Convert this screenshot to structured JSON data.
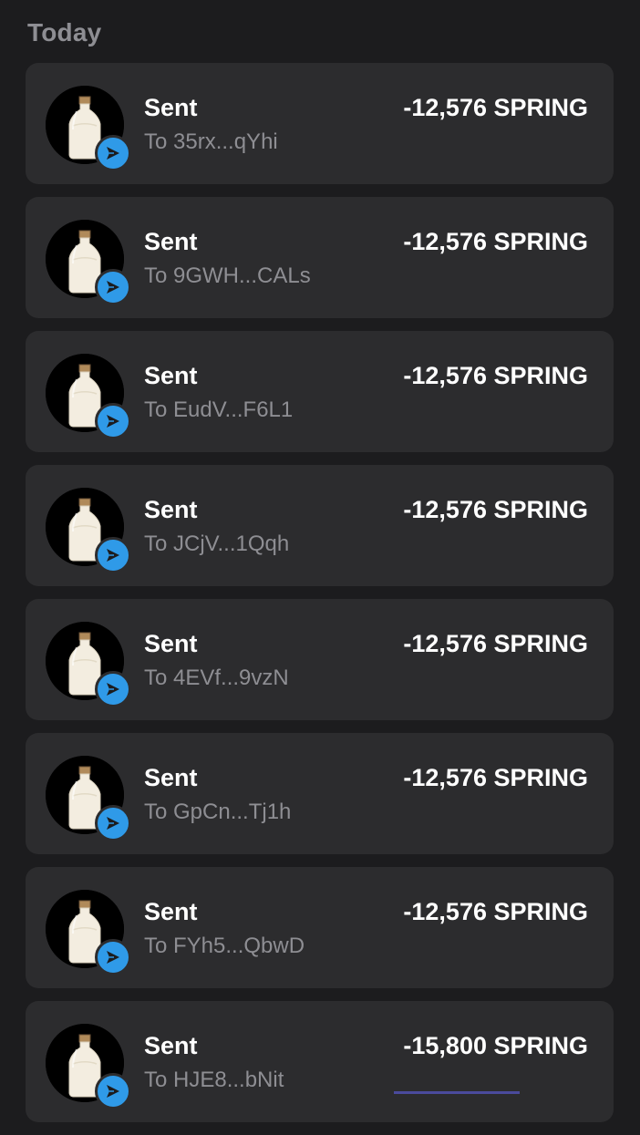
{
  "section": {
    "title": "Today"
  },
  "colors": {
    "background": "#1c1c1e",
    "card": "#2c2c2e",
    "badge": "#2f9ae8",
    "muted_text": "#8e8e93"
  },
  "icons": {
    "avatar": "bottle-icon",
    "badge": "send-icon"
  },
  "transactions": [
    {
      "title": "Sent",
      "recipient": "To 35rx...qYhi",
      "amount": "-12,576 SPRING"
    },
    {
      "title": "Sent",
      "recipient": "To 9GWH...CALs",
      "amount": "-12,576 SPRING"
    },
    {
      "title": "Sent",
      "recipient": "To EudV...F6L1",
      "amount": "-12,576 SPRING"
    },
    {
      "title": "Sent",
      "recipient": "To JCjV...1Qqh",
      "amount": "-12,576 SPRING"
    },
    {
      "title": "Sent",
      "recipient": "To 4EVf...9vzN",
      "amount": "-12,576 SPRING"
    },
    {
      "title": "Sent",
      "recipient": "To GpCn...Tj1h",
      "amount": "-12,576 SPRING"
    },
    {
      "title": "Sent",
      "recipient": "To FYh5...QbwD",
      "amount": "-12,576 SPRING"
    },
    {
      "title": "Sent",
      "recipient": "To HJE8...bNit",
      "amount": "-15,800 SPRING"
    }
  ]
}
